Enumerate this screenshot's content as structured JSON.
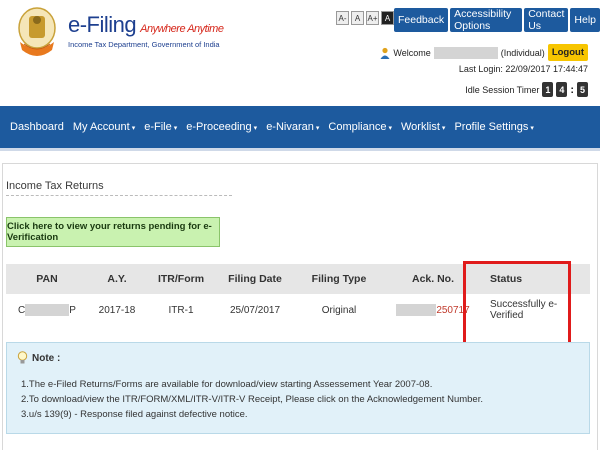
{
  "brand": {
    "title": "e-Filing",
    "tagline": "Anywhere Anytime",
    "subtitle": "Income Tax Department, Government of India"
  },
  "font_controls": [
    "A-",
    "A",
    "A+",
    "A",
    "A"
  ],
  "topnav": [
    "Feedback",
    "Accessibility Options",
    "Contact Us",
    "Help"
  ],
  "user": {
    "welcome": "Welcome",
    "type": "(Individual)",
    "logout": "Logout",
    "last_login": "Last Login: 22/09/2017 17:44:47",
    "idle_label": "Idle Session Timer",
    "idle_digits": [
      "1",
      "4",
      "5"
    ]
  },
  "mainnav": [
    "Dashboard",
    "My Account",
    "e-File",
    "e-Proceeding",
    "e-Nivaran",
    "Compliance",
    "Worklist",
    "Profile Settings"
  ],
  "section": {
    "title": "Income Tax Returns",
    "pending_button": "Click here to view your returns pending for e-Verification"
  },
  "table": {
    "headers": [
      "PAN",
      "A.Y.",
      "ITR/Form",
      "Filing Date",
      "Filing Type",
      "Ack. No.",
      "Status"
    ],
    "rows": [
      {
        "pan_start": "C",
        "pan_end": "P",
        "ay": "2017-18",
        "itr": "ITR-1",
        "filing_date": "25/07/2017",
        "filing_type": "Original",
        "ack_suffix": "250717",
        "status": "Successfully e-Verified"
      }
    ]
  },
  "note": {
    "title": "Note :",
    "lines": [
      "1.The e-Filed Returns/Forms are available for download/view starting Assessement Year 2007-08.",
      "2.To download/view the ITR/FORM/XML/ITR-V/ITR-V Receipt, Please click on the Acknowledgement Number.",
      "3.u/s 139(9) - Response filed against defective notice."
    ]
  },
  "colors": {
    "nav_blue": "#1d5a9e",
    "logout_yellow": "#f7c500",
    "highlight_red": "#e01b1b",
    "pending_green": "#c9f2b0"
  }
}
